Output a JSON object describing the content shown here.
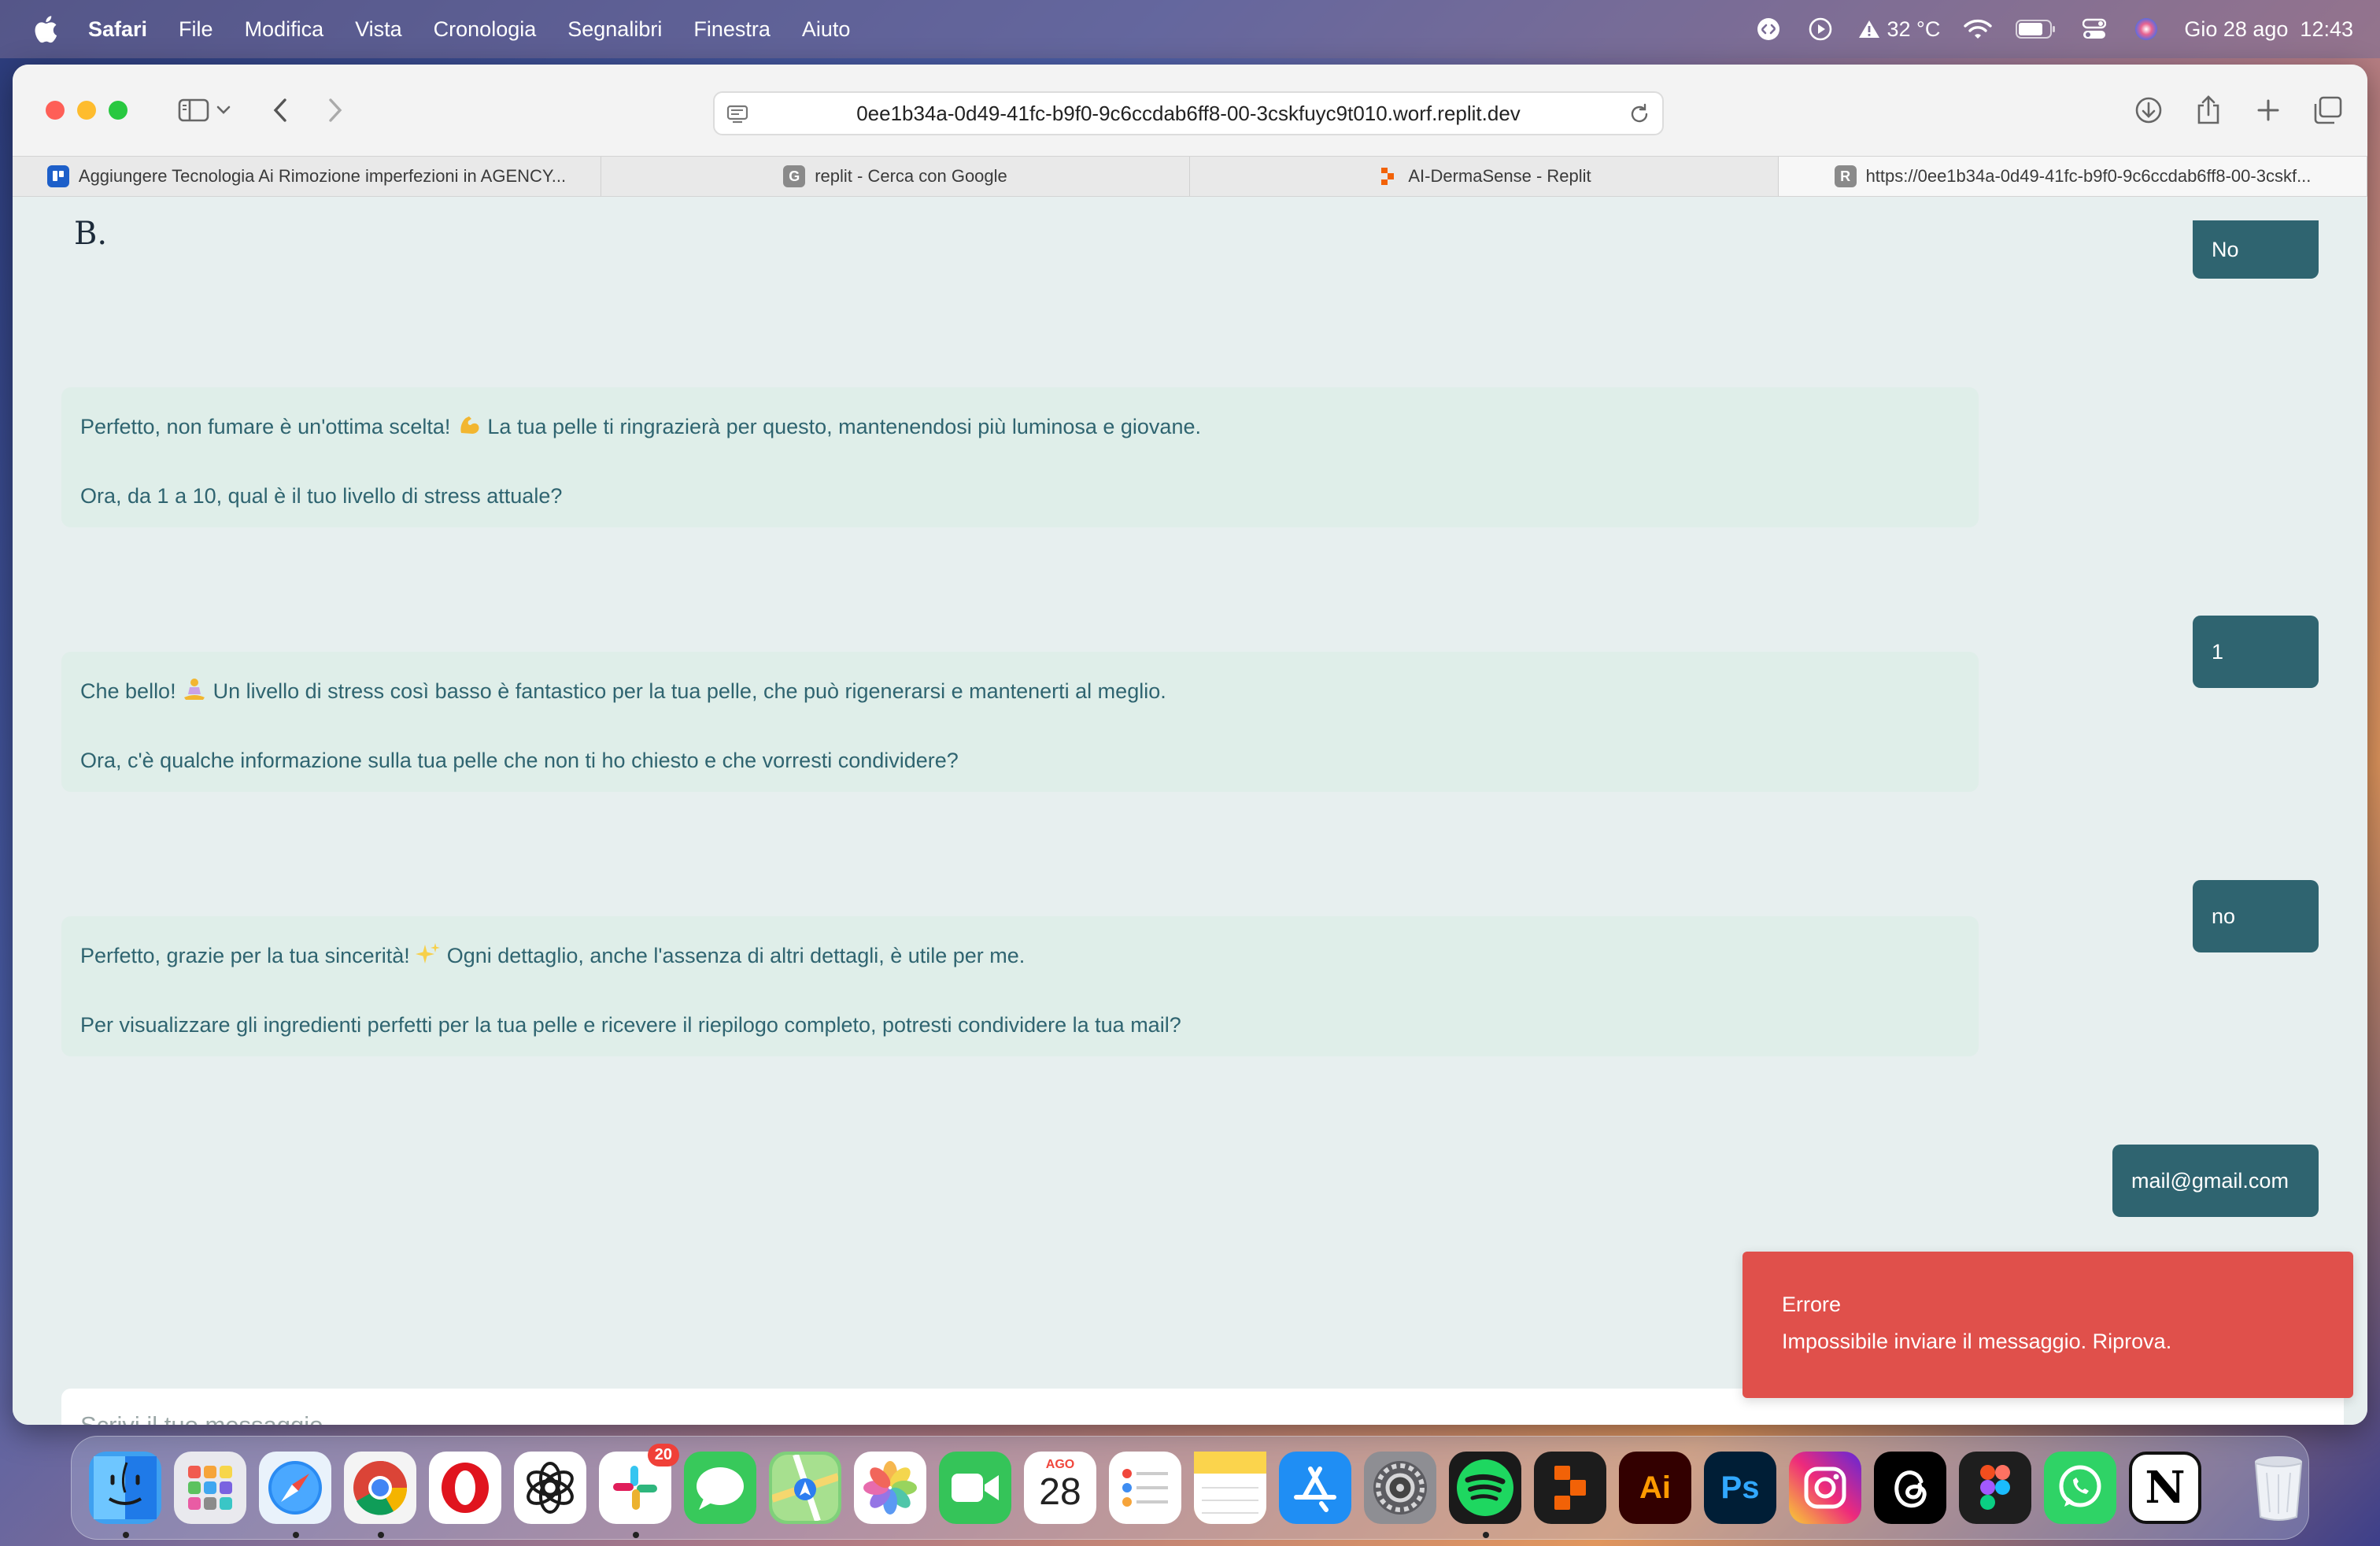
{
  "menubar": {
    "app": "Safari",
    "items": [
      "File",
      "Modifica",
      "Vista",
      "Cronologia",
      "Segnalibri",
      "Finestra",
      "Aiuto"
    ],
    "weather": "32 °C",
    "datetime": "Gio 28 ago  12:43"
  },
  "browser": {
    "url": "0ee1b34a-0d49-41fc-b9f0-9c6ccdab6ff8-00-3cskfuyc9t010.worf.replit.dev",
    "tabs": [
      {
        "title": "Aggiungere Tecnologia Ai Rimozione imperfezioni in AGENCY...",
        "favicon": "trello",
        "color": "#1d5fc9",
        "letter": ""
      },
      {
        "title": "replit - Cerca con Google",
        "favicon": "google-g",
        "color": "#8a8a8a",
        "letter": "G"
      },
      {
        "title": "AI-DermaSense - Replit",
        "favicon": "replit",
        "color": "#f26207",
        "letter": ""
      },
      {
        "title": "https://0ee1b34a-0d49-41fc-b9f0-9c6ccdab6ff8-00-3cskf...",
        "favicon": "letter-r",
        "color": "#8a8a8a",
        "letter": "R"
      }
    ]
  },
  "chat": {
    "logo": "B.",
    "messages": [
      {
        "role": "user",
        "text": "No"
      },
      {
        "role": "bot",
        "line1a": "Perfetto, non fumare è un'ottima scelta! ",
        "emoji1": "flexed-biceps",
        "line1b": " La tua pelle ti ringrazierà per questo, mantenendosi più luminosa e giovane.",
        "line2": "Ora, da 1 a 10, qual è il tuo livello di stress attuale?"
      },
      {
        "role": "user",
        "text": "1"
      },
      {
        "role": "bot",
        "line1a": "Che bello! ",
        "emoji1": "person-meditating",
        "line1b": " Un livello di stress così basso è fantastico per la tua pelle, che può rigenerarsi e mantenerti al meglio.",
        "line2": "Ora, c'è qualche informazione sulla tua pelle che non ti ho chiesto e che vorresti condividere?"
      },
      {
        "role": "user",
        "text": "no"
      },
      {
        "role": "bot",
        "line1a": "Perfetto, grazie per la tua sincerità! ",
        "emoji1": "sparkles",
        "line1b": " Ogni dettaglio, anche l'assenza di altri dettagli, è utile per me.",
        "line2": "Per visualizzare gli ingredienti perfetti per la tua pelle e ricevere il riepilogo completo, potresti condividere la tua mail?"
      },
      {
        "role": "user",
        "text": "mail@gmail.com"
      }
    ],
    "composer_placeholder": "Scrivi il tuo messaggio..."
  },
  "toast": {
    "title": "Errore",
    "body": "Impossibile inviare il messaggio. Riprova."
  },
  "dock": {
    "apps": [
      {
        "name": "finder",
        "bg": "#3ea0f0",
        "label": "",
        "running": true
      },
      {
        "name": "launchpad",
        "bg": "#e9e9ee",
        "label": "",
        "running": false
      },
      {
        "name": "safari",
        "bg": "#e9f2fb",
        "label": "",
        "running": true
      },
      {
        "name": "chrome",
        "bg": "#f4f4f4",
        "label": "",
        "running": true
      },
      {
        "name": "opera",
        "bg": "#ffffff",
        "label": "",
        "running": false
      },
      {
        "name": "chatgpt",
        "bg": "#ffffff",
        "label": "",
        "running": false
      },
      {
        "name": "slack",
        "bg": "#ffffff",
        "label": "",
        "running": true,
        "badge": "20"
      },
      {
        "name": "messages",
        "bg": "#38c95b",
        "label": "",
        "running": false
      },
      {
        "name": "maps",
        "bg": "#7fd07a",
        "label": "",
        "running": false
      },
      {
        "name": "photos",
        "bg": "#ffffff",
        "label": "",
        "running": false
      },
      {
        "name": "facetime",
        "bg": "#35c459",
        "label": "",
        "running": false
      },
      {
        "name": "calendar",
        "bg": "#ffffff",
        "label": "28",
        "month": "AGO",
        "running": false
      },
      {
        "name": "reminders",
        "bg": "#ffffff",
        "label": "",
        "running": false
      },
      {
        "name": "notes",
        "bg": "#fbe27a",
        "label": "",
        "running": false
      },
      {
        "name": "app-store",
        "bg": "#1f8ef4",
        "label": "",
        "running": false
      },
      {
        "name": "system-settings",
        "bg": "#8e8e93",
        "label": "",
        "running": false
      },
      {
        "name": "spotify",
        "bg": "#1a1a1a",
        "label": "",
        "running": true
      },
      {
        "name": "replit",
        "bg": "#1c1c1c",
        "label": "",
        "running": false
      },
      {
        "name": "illustrator",
        "bg": "#330000",
        "label": "Ai",
        "color": "#ff9a00",
        "running": false
      },
      {
        "name": "photoshop",
        "bg": "#001e36",
        "label": "Ps",
        "color": "#31a8ff",
        "running": false
      },
      {
        "name": "instagram",
        "bg": "#d6287a",
        "label": "",
        "running": false
      },
      {
        "name": "threads",
        "bg": "#000000",
        "label": "",
        "running": false
      },
      {
        "name": "figma",
        "bg": "#1e1e1e",
        "label": "",
        "running": false
      },
      {
        "name": "whatsapp",
        "bg": "#2fd366",
        "label": "",
        "running": false
      },
      {
        "name": "notion",
        "bg": "#ffffff",
        "label": "N",
        "color": "#000",
        "running": false
      }
    ],
    "trash": "trash"
  }
}
